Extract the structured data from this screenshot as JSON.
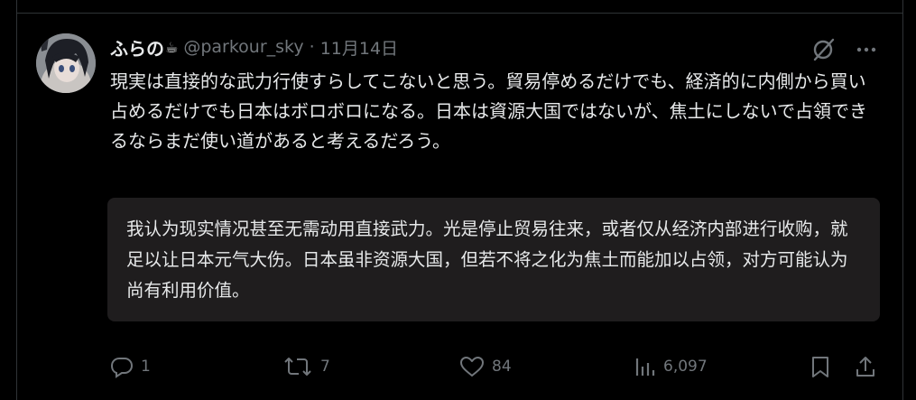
{
  "tweet": {
    "display_name": "ふらの",
    "name_emoji": "☕",
    "handle": "@parkour_sky",
    "separator": "·",
    "date": "11月14日",
    "text": "現実は直接的な武力行使すらしてこないと思う。貿易停めるだけでも、経済的に内側から買い占めるだけでも日本はボロボロになる。日本は資源大国ではないが、焦土にしないで占領できるならまだ使い道があると考えるだろう。",
    "translation": "我认为现实情况甚至无需动用直接武力。光是停止贸易往来，或者仅从经济内部进行收购，就足以让日本元气大伤。日本虽非资源大国，但若不将之化为焦土而能加以占领，对方可能认为尚有利用价值。"
  },
  "header_icons": [
    "grok-icon",
    "more-icon"
  ],
  "actions": {
    "reply_count": "1",
    "retweet_count": "7",
    "like_count": "84",
    "views_count": "6,097"
  },
  "colors": {
    "background": "#000000",
    "text": "#e7e9ea",
    "secondary": "#71767b",
    "translation_bg": "#1f1d1e",
    "border": "#2f3336"
  }
}
